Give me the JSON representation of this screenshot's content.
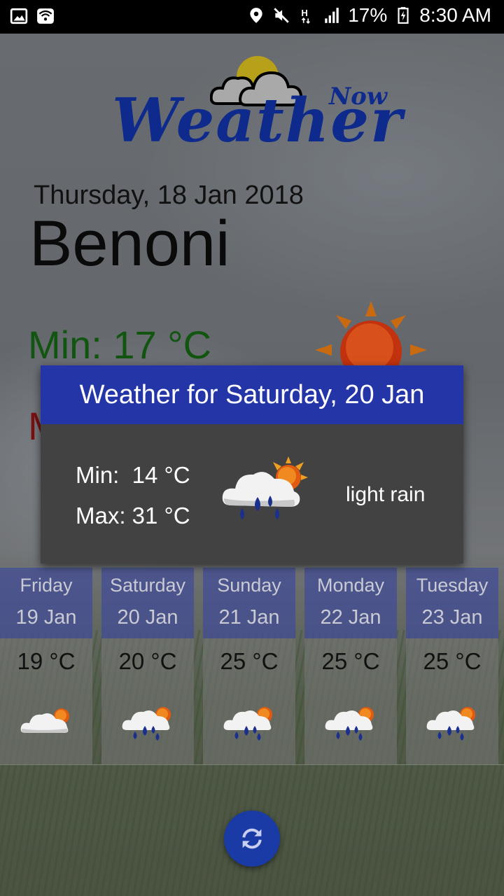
{
  "status_bar": {
    "battery": "17%",
    "time": "8:30 AM",
    "icons": [
      "image-icon",
      "wifi-icon",
      "location-icon",
      "mute-icon",
      "hspa-icon",
      "signal-icon",
      "battery-icon"
    ]
  },
  "app": {
    "logo_text": "Weather",
    "logo_subtext": "Now"
  },
  "current": {
    "date": "Thursday, 18 Jan 2018",
    "city": "Benoni",
    "min": "Min:  17 °C",
    "max_partial": "M"
  },
  "popup": {
    "title": "Weather for Saturday, 20 Jan",
    "min": "Min:  14 °C",
    "max": "Max: 31 °C",
    "description": "light rain",
    "icon": "rain-sun-icon"
  },
  "forecast": [
    {
      "day": "Friday",
      "date": "19 Jan",
      "temp": "19 °C",
      "icon": "cloud-sun-icon"
    },
    {
      "day": "Saturday",
      "date": "20 Jan",
      "temp": "20 °C",
      "icon": "rain-sun-icon"
    },
    {
      "day": "Sunday",
      "date": "21 Jan",
      "temp": "25 °C",
      "icon": "rain-sun-icon"
    },
    {
      "day": "Monday",
      "date": "22 Jan",
      "temp": "25 °C",
      "icon": "rain-sun-icon"
    },
    {
      "day": "Tuesday",
      "date": "23 Jan",
      "temp": "25 °C",
      "icon": "rain-sun-icon"
    }
  ],
  "refresh_button": {
    "icon": "refresh-icon"
  },
  "colors": {
    "header_blue": "#2435a8",
    "fab_blue": "#1a3aa6",
    "min_green": "#115511",
    "max_red": "#7a1010",
    "logo_blue": "#0d2a8c"
  }
}
